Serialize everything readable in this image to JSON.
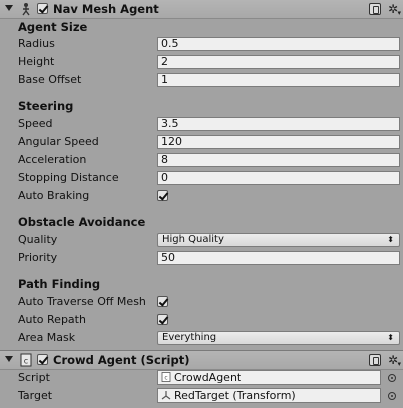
{
  "nav_mesh_agent": {
    "title": "Nav Mesh Agent",
    "enabled": true,
    "agent_size": {
      "heading": "Agent Size",
      "radius_label": "Radius",
      "radius": "0.5",
      "height_label": "Height",
      "height": "2",
      "base_offset_label": "Base Offset",
      "base_offset": "1"
    },
    "steering": {
      "heading": "Steering",
      "speed_label": "Speed",
      "speed": "3.5",
      "angular_speed_label": "Angular Speed",
      "angular_speed": "120",
      "acceleration_label": "Acceleration",
      "acceleration": "8",
      "stopping_distance_label": "Stopping Distance",
      "stopping_distance": "0",
      "auto_braking_label": "Auto Braking",
      "auto_braking": true
    },
    "obstacle_avoidance": {
      "heading": "Obstacle Avoidance",
      "quality_label": "Quality",
      "quality": "High Quality",
      "priority_label": "Priority",
      "priority": "50"
    },
    "path_finding": {
      "heading": "Path Finding",
      "auto_traverse_label": "Auto Traverse Off Mesh",
      "auto_traverse": true,
      "auto_repath_label": "Auto Repath",
      "auto_repath": true,
      "area_mask_label": "Area Mask",
      "area_mask": "Everything"
    }
  },
  "crowd_agent": {
    "title": "Crowd Agent (Script)",
    "enabled": true,
    "script_label": "Script",
    "script": "CrowdAgent",
    "target_label": "Target",
    "target": "RedTarget (Transform)"
  }
}
